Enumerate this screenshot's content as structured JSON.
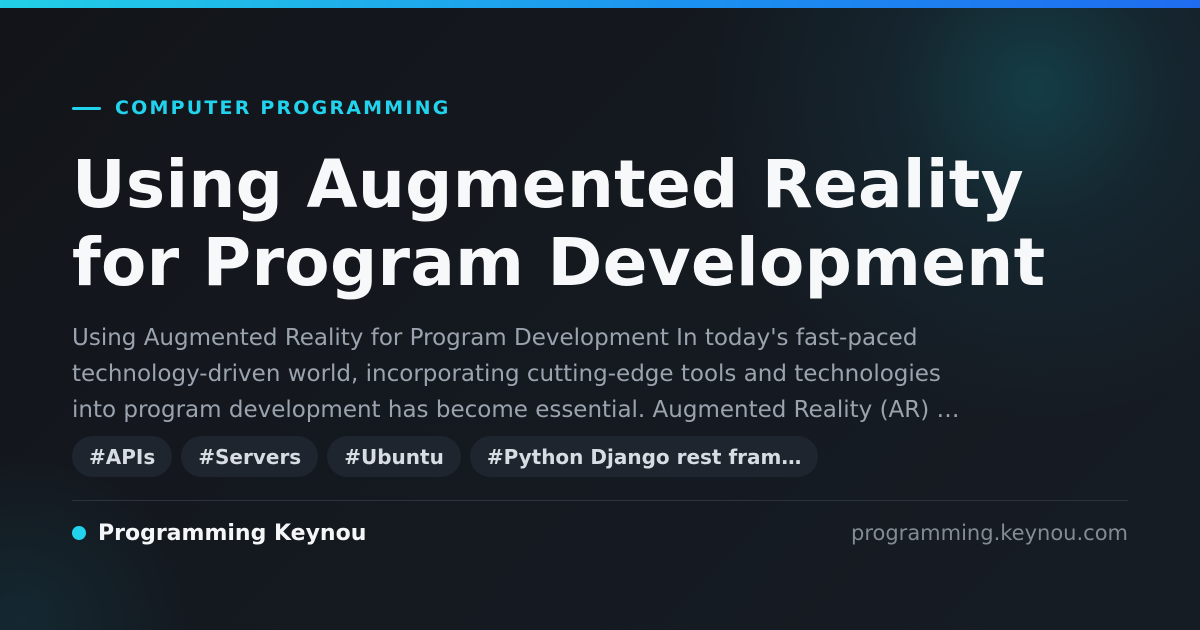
{
  "category": "COMPUTER PROGRAMMING",
  "headline": {
    "line1": "Using Augmented Reality",
    "line2": "for Program Development"
  },
  "excerpt": {
    "line1": "Using Augmented Reality for Program Development In today's fast-paced",
    "line2": "technology-driven world, incorporating cutting-edge tools and technologies",
    "line3": "into program development has become essential. Augmented Reality (AR) …"
  },
  "tags": [
    "#APIs",
    "#Servers",
    "#Ubuntu",
    "#Python Django rest fram…"
  ],
  "brand": {
    "name": "Programming Keynou",
    "url": "programming.keynou.com"
  },
  "colors": {
    "accent": "#22d3ee",
    "background": "#14181f",
    "top_bar_start": "#22cfe6",
    "top_bar_end": "#1f6cf0"
  }
}
